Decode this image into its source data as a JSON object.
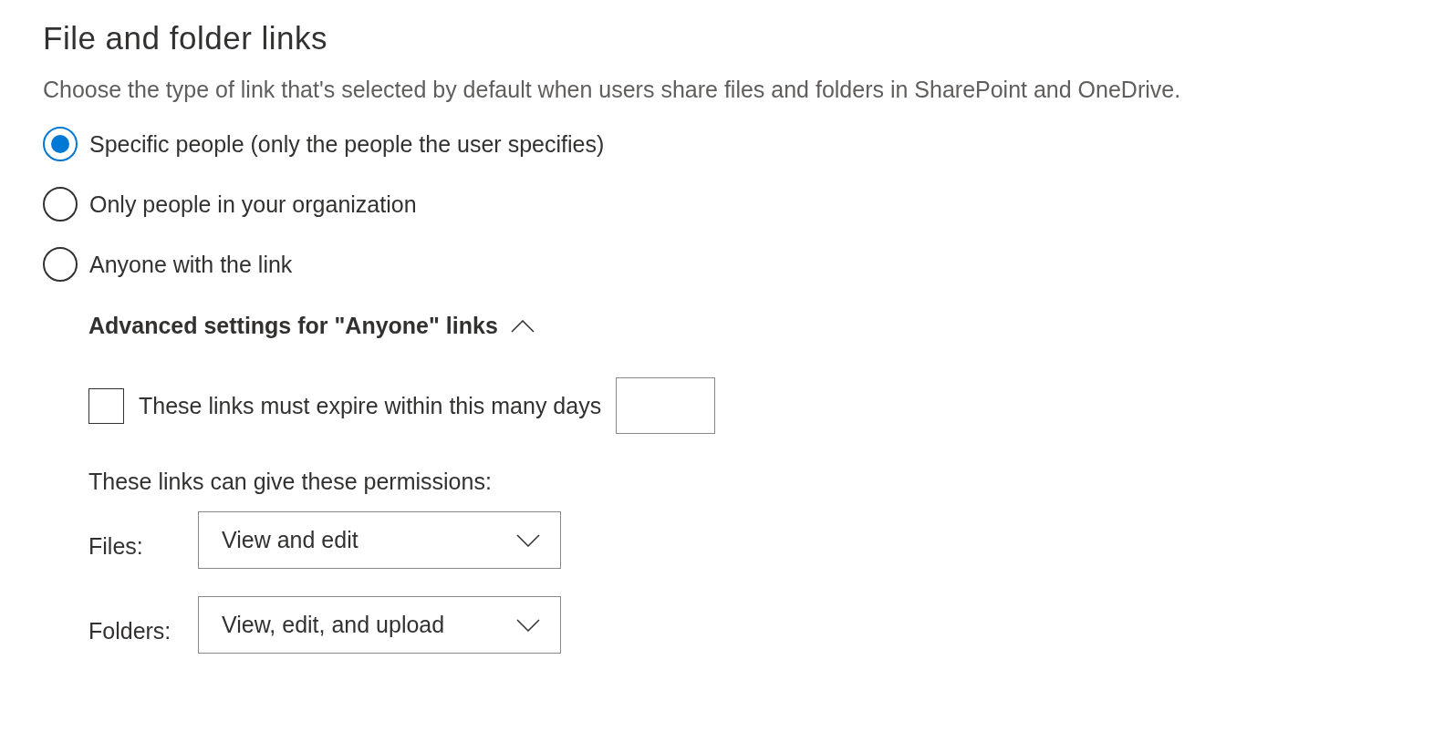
{
  "title": "File and folder links",
  "description": "Choose the type of link that's selected by default when users share files and folders in SharePoint and OneDrive.",
  "options": [
    {
      "label": "Specific people (only the people the user specifies)",
      "selected": true
    },
    {
      "label": "Only people in your organization",
      "selected": false
    },
    {
      "label": "Anyone with the link",
      "selected": false
    }
  ],
  "advanced": {
    "title": "Advanced settings for \"Anyone\" links",
    "expanded": true,
    "expire": {
      "label": "These links must expire within this many days",
      "checked": false
    },
    "permissions_label": "These links can give these permissions:",
    "dropdowns": [
      {
        "label": "Files:",
        "value": "View and edit"
      },
      {
        "label": "Folders:",
        "value": "View, edit, and upload"
      }
    ]
  }
}
